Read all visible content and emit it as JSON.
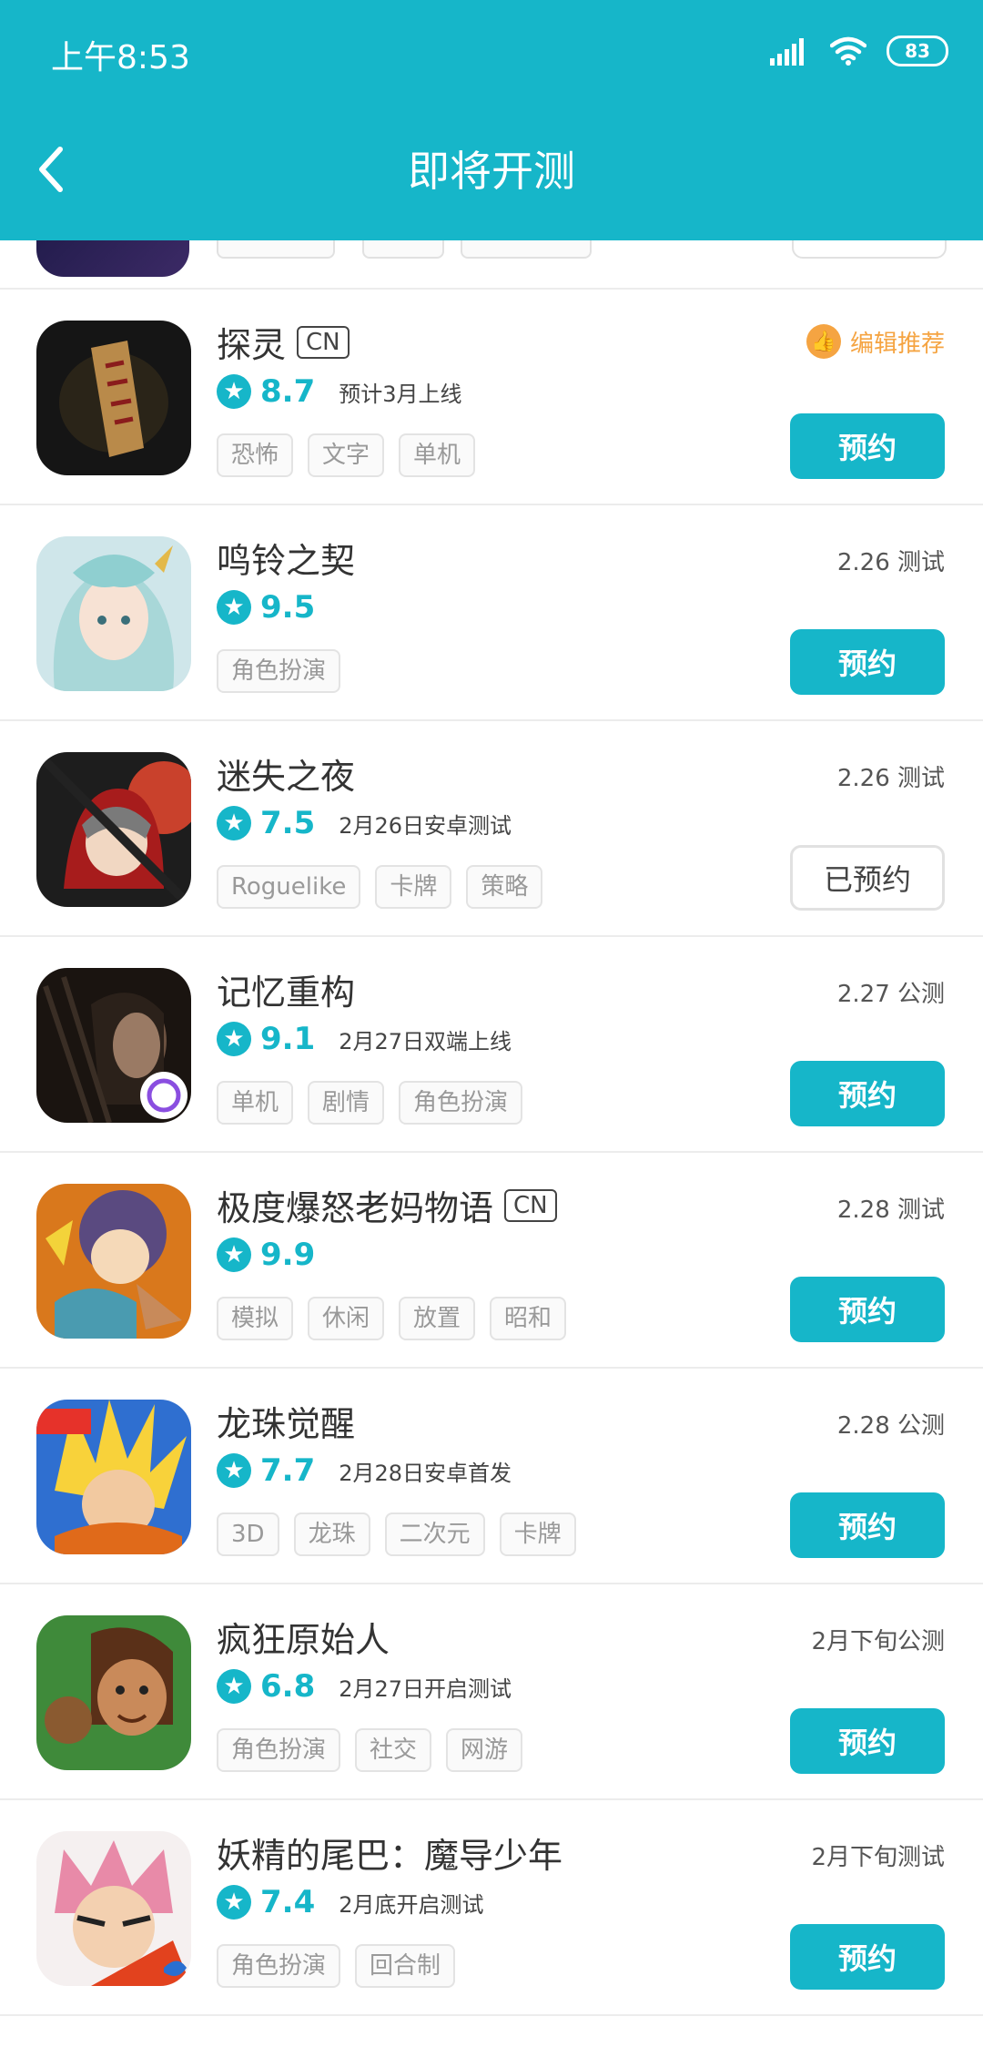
{
  "status_bar": {
    "time": "上午8:53",
    "battery": "83"
  },
  "header": {
    "title": "即将开测"
  },
  "colors": {
    "accent": "#16b6c9",
    "editor_pick": "#f5a442"
  },
  "games": [
    {
      "name": "探灵",
      "cn": "CN",
      "score": "8.7",
      "note": "预计3月上线",
      "tags": [
        "恐怖",
        "文字",
        "单机"
      ],
      "status": "编辑推荐",
      "button": "预约",
      "reserved": false,
      "icon": "talisman-icon"
    },
    {
      "name": "鸣铃之契",
      "cn": "",
      "score": "9.5",
      "note": "",
      "tags": [
        "角色扮演"
      ],
      "status": "2.26 测试",
      "button": "预约",
      "reserved": false,
      "icon": "anime-girl-icon"
    },
    {
      "name": "迷失之夜",
      "cn": "",
      "score": "7.5",
      "note": "2月26日安卓测试",
      "tags": [
        "Roguelike",
        "卡牌",
        "策略"
      ],
      "status": "2.26 测试",
      "button": "已预约",
      "reserved": true,
      "icon": "hooded-figure-icon"
    },
    {
      "name": "记忆重构",
      "cn": "",
      "score": "9.1",
      "note": "2月27日双端上线",
      "tags": [
        "单机",
        "剧情",
        "角色扮演"
      ],
      "status": "2.27 公测",
      "button": "预约",
      "reserved": false,
      "icon": "dark-portrait-icon"
    },
    {
      "name": "极度爆怒老妈物语",
      "cn": "CN",
      "score": "9.9",
      "note": "",
      "tags": [
        "模拟",
        "休闲",
        "放置",
        "昭和"
      ],
      "status": "2.28 测试",
      "button": "预约",
      "reserved": false,
      "icon": "angry-mom-icon"
    },
    {
      "name": "龙珠觉醒",
      "cn": "",
      "score": "7.7",
      "note": "2月28日安卓首发",
      "tags": [
        "3D",
        "龙珠",
        "二次元",
        "卡牌"
      ],
      "status": "2.28 公测",
      "button": "预约",
      "reserved": false,
      "icon": "super-saiyan-icon"
    },
    {
      "name": "疯狂原始人",
      "cn": "",
      "score": "6.8",
      "note": "2月27日开启测试",
      "tags": [
        "角色扮演",
        "社交",
        "网游"
      ],
      "status": "2月下旬公测",
      "button": "预约",
      "reserved": false,
      "icon": "caveman-icon"
    },
    {
      "name": "妖精的尾巴：魔导少年",
      "cn": "",
      "score": "7.4",
      "note": "2月底开启测试",
      "tags": [
        "角色扮演",
        "回合制"
      ],
      "status": "2月下旬测试",
      "button": "预约",
      "reserved": false,
      "icon": "fairy-tail-icon"
    }
  ]
}
